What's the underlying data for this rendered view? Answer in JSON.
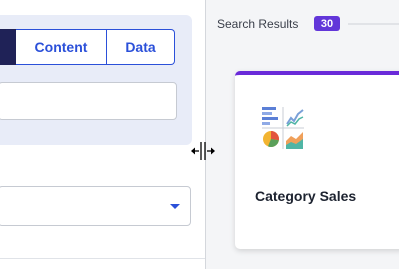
{
  "tabs": [
    {
      "label": "",
      "state": "active"
    },
    {
      "label": "Content",
      "state": "normal"
    },
    {
      "label": "Data",
      "state": "normal"
    }
  ],
  "name_field": {
    "value": "",
    "placeholder": ""
  },
  "dropdown": {
    "value": "",
    "icon": "chevron-down-icon"
  },
  "search_results": {
    "label": "Search Results",
    "count": "30"
  },
  "cards": [
    {
      "title": "Category Sales",
      "icon": "chart-types-icon",
      "accent": "#6a2ad9"
    }
  ],
  "colors": {
    "accent": "#2b50d9",
    "active_tab": "#1f2257",
    "badge": "#6236d9",
    "card_accent": "#6a2ad9"
  }
}
